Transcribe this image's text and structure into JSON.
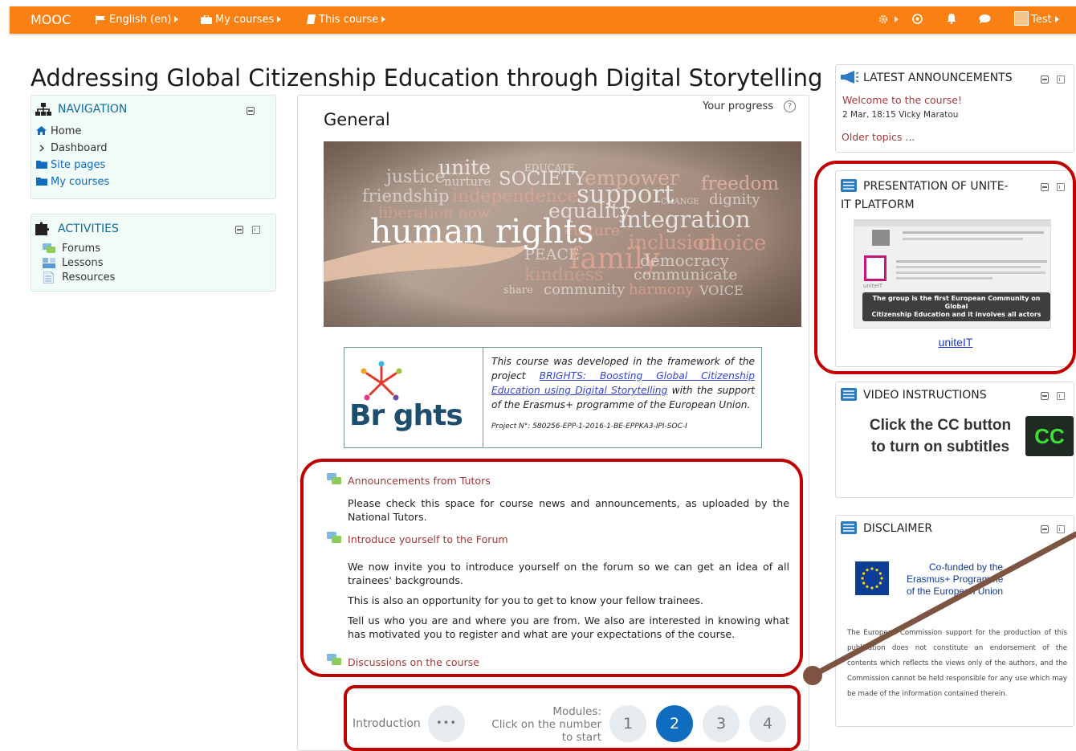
{
  "topbar": {
    "brand": "MOOC",
    "language": "English (en)",
    "my_courses": "My courses",
    "this_course": "This course",
    "user_name": "Test",
    "color": "#f98012"
  },
  "page_title": "Addressing Global Citizenship Education through Digital Storytelling",
  "navigation": {
    "title": "NAVIGATION",
    "items": [
      "Home",
      "Dashboard",
      "Site pages",
      "My courses"
    ]
  },
  "activities": {
    "title": "ACTIVITIES",
    "items": [
      "Forums",
      "Lessons",
      "Resources"
    ]
  },
  "course": {
    "progress_label": "Your progress",
    "progress_help": "?",
    "section_title": "General",
    "banner_words": [
      "justice",
      "unite",
      "EDUCATE",
      "nurture",
      "SOCIETY",
      "empower",
      "freedom",
      "friendship",
      "independence",
      "support",
      "dignity",
      "liberation now",
      "CHANGE",
      "equality",
      "integration",
      "human rights",
      "culture",
      "inclusion",
      "choice",
      "PEACE",
      "family",
      "democracy",
      "kindness",
      "communicate",
      "share",
      "community",
      "harmony",
      "VOICE"
    ],
    "brights_logo": "Br ghts",
    "brights_intro": "This course was developed in the framework of the project",
    "brights_link": "BRIGHTS: Boosting Global Citizenship Education using Digital Storytelling",
    "brights_tail": "with the support of the Erasmus+ programme of the European Union.",
    "project_no": "Project N°: 580256-EPP-1-2016-1-BE-EPPKA3-IPI-SOC-I",
    "activities": [
      {
        "title": "Announcements from Tutors",
        "desc": [
          "Please check this space for course news and announcements, as uploaded by the National Tutors."
        ]
      },
      {
        "title": "Introduce yourself to the Forum",
        "desc": [
          "We now invite you to introduce yourself on the forum so we can get an idea of all trainees' backgrounds.",
          "This is also an opportunity for you to get to know your fellow trainees.",
          "Tell us who you are and where you are from. We also are interested in knowing what has motivated you to register and what are your expectations of the course."
        ]
      },
      {
        "title": "Discussions on the course",
        "desc": []
      }
    ],
    "intro_label": "Introduction",
    "intro_dots": "•••",
    "modules_label_1": "Modules:",
    "modules_label_2": "Click on the number",
    "modules_label_3": "to start",
    "modules": [
      "1",
      "2",
      "3",
      "4"
    ],
    "active_module": "2"
  },
  "right": {
    "announcements": {
      "title": "LATEST ANNOUNCEMENTS",
      "post": "Welcome to the course!",
      "meta": "2 Mar, 18:15 Vicky Maratou",
      "older": "Older topics ..."
    },
    "presentation": {
      "title_1": "PRESENTATION OF UNITE-",
      "title_2": "IT PLATFORM",
      "caption_1": "The group is the first European Community on",
      "caption_2": "Global",
      "caption_3": "Citizenship Education and it involves all actors",
      "link": "uniteIT",
      "thumb_logo_text": "uniteIT"
    },
    "video": {
      "title": "VIDEO INSTRUCTIONS",
      "line1": "Click the CC button",
      "line2": "to turn on subtitles",
      "cc": "CC"
    },
    "disclaimer": {
      "title": "DISCLAIMER",
      "cofund_1": "Co-funded by the",
      "cofund_2": "Erasmus+ Programme",
      "cofund_3": "of the European Union",
      "text": "The European Commission support for the production of this publication does not constitute an endorsement of the contents which reflects the views only of the authors, and the Commission cannot be held responsible for any use which may be made of the information contained therein."
    }
  }
}
